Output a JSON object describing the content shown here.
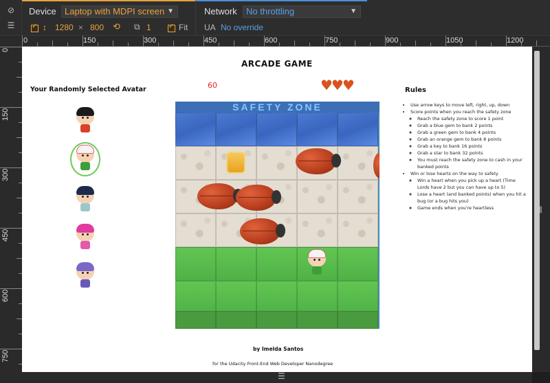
{
  "devtools": {
    "device_label": "Device",
    "device_value": "Laptop with MDPI screen",
    "network_label": "Network",
    "network_value": "No throttling",
    "width": "1280",
    "times": "×",
    "height": "800",
    "scale": "1",
    "fit_label": "Fit",
    "ua_label": "UA",
    "ua_value": "No override"
  },
  "ruler": {
    "top_labels": [
      "0",
      "150",
      "300",
      "450",
      "600",
      "750",
      "900",
      "1050",
      "1200"
    ],
    "left_labels": [
      "0",
      "150",
      "300",
      "450",
      "600",
      "750"
    ]
  },
  "game": {
    "title": "ARCADE GAME",
    "avatar_heading": "Your Randomly Selected Avatar",
    "score": "60",
    "hearts": "♥♥♥",
    "safety_zone_text": "SAFETY ZONE",
    "rules_heading": "Rules",
    "rules": [
      {
        "text": "Use arrow keys to move left, right, up, down",
        "sub": []
      },
      {
        "text": "Score points when you reach the safety zone",
        "sub": [
          "Reach the safety zone to score 1 point",
          "Grab a blue gem to bank 2 points",
          "Grab a green gem to bank 4 points",
          "Grab an orange gem to bank 8 points",
          "Grab a key to bank 16 points",
          "Grab a star to bank 32 points",
          "You must reach the safety zone to cash in your banked points"
        ]
      },
      {
        "text": "Win or lose hearts on the way to safety",
        "sub": [
          "Win a heart when you pick up a heart (Time Lords have 2 but you can have up to 5)",
          "Lose a heart (and banked points) when you hit a bug (or a bug hits you)",
          "Game ends when you're heartless"
        ]
      }
    ],
    "footer_author": "by Imelda Santos",
    "footer_note": "for the Udacity Front-End Web Developer Nanodegree"
  },
  "colors": {
    "device_accent": "#e8a33d",
    "network_accent": "#4a90d9",
    "score_color": "#e22222",
    "heart_color": "#d9531e",
    "selection_ring": "#6ccb5b"
  }
}
